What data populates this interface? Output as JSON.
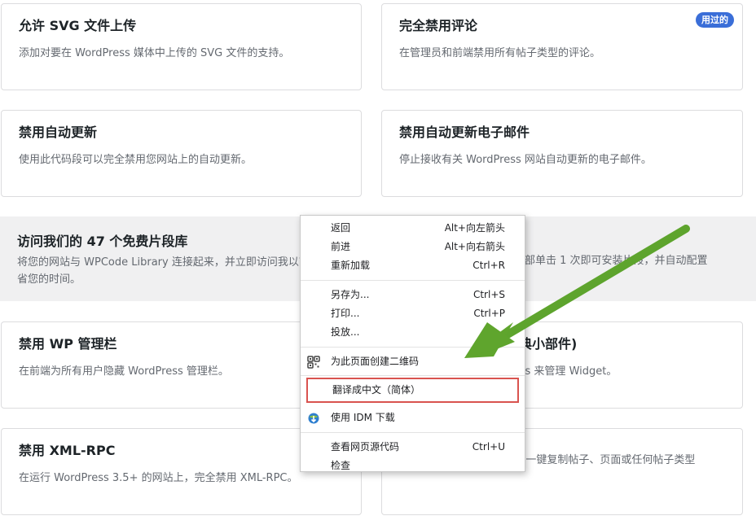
{
  "cards": [
    {
      "title": "允许 SVG 文件上传",
      "desc": "添加对要在 WordPress 媒体中上传的 SVG 文件的支持。"
    },
    {
      "title": "完全禁用评论",
      "desc": "在管理员和前端禁用所有帖子类型的评论。",
      "badge": "用过的"
    },
    {
      "title": "禁用自动更新",
      "desc": "使用此代码段可以完全禁用您网站上的自动更新。"
    },
    {
      "title": "禁用自动更新电子邮件",
      "desc": "停止接收有关 WordPress 网站自动更新的电子邮件。"
    },
    {
      "title": "禁用 WP 管理栏",
      "desc": "在前端为所有用户隐藏 WordPress 管理栏。"
    },
    {
      "title": "典小部件)",
      "desc": "ks 来管理 Widget。"
    },
    {
      "title": "禁用 XML-RPC",
      "desc": "在运行 WordPress 3.5+ 的网站上，完全禁用 XML-RPC。"
    },
    {
      "title": "",
      "desc": "通过在...中添加重复链接，一键复制帖子、页面或任何帖子类型"
    }
  ],
  "banner": {
    "title": "访问我们的 47 个免费片段库",
    "desc_left": "将您的网站与 WPCode Library 连接起来，并立即访问我以节省您的时间。",
    "desc_right": "部单击 1 次即可安装片段，并自动配置"
  },
  "context_menu": {
    "items": [
      {
        "label": "返回",
        "shortcut": "Alt+向左箭头"
      },
      {
        "label": "前进",
        "shortcut": "Alt+向右箭头"
      },
      {
        "label": "重新加载",
        "shortcut": "Ctrl+R"
      },
      {
        "label": "另存为...",
        "shortcut": "Ctrl+S"
      },
      {
        "label": "打印...",
        "shortcut": "Ctrl+P"
      },
      {
        "label": "投放...",
        "shortcut": ""
      },
      {
        "label": "为此页面创建二维码",
        "shortcut": "",
        "icon": "qr-code-icon"
      },
      {
        "label": "翻译成中文（简体）",
        "shortcut": "",
        "highlighted": true
      },
      {
        "label": "使用 IDM 下载",
        "shortcut": "",
        "icon": "idm-download-icon"
      },
      {
        "label": "查看网页源代码",
        "shortcut": "Ctrl+U"
      },
      {
        "label": "检查",
        "shortcut": ""
      }
    ]
  },
  "colors": {
    "badge": "#3a6ed8",
    "highlight_border": "#d9534f",
    "arrow": "#5fa52d"
  }
}
